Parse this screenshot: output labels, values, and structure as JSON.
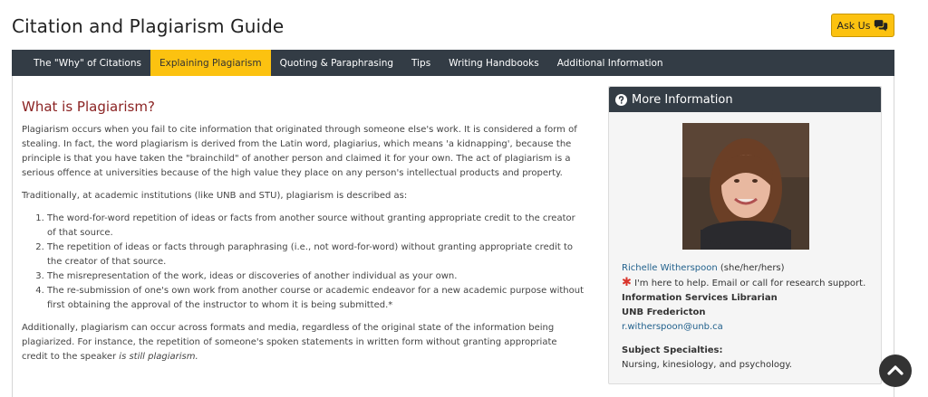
{
  "header": {
    "title": "Citation and Plagiarism Guide",
    "ask_us_label": "Ask Us"
  },
  "nav": {
    "tabs": [
      {
        "label": "The \"Why\" of Citations",
        "active": false
      },
      {
        "label": "Explaining Plagiarism",
        "active": true
      },
      {
        "label": "Quoting & Paraphrasing",
        "active": false
      },
      {
        "label": "Tips",
        "active": false
      },
      {
        "label": "Writing Handbooks",
        "active": false
      },
      {
        "label": "Additional Information",
        "active": false
      }
    ]
  },
  "main": {
    "heading": "What is Plagiarism?",
    "para1": "Plagiarism occurs when you fail to cite information that originated through someone else's work.  It is considered a form of stealing.  In fact, the word plagiarism is derived from the Latin word, plagiarius, which means 'a kidnapping', because the principle is that you have taken the \"brainchild\" of another person and claimed it for your own.  The act of plagiarism is a serious offence at universities because of the high value they place on any person's intellectual products and property.",
    "para2": "Traditionally, at academic institutions (like UNB and STU), plagiarism is described as:",
    "list": [
      "The word-for-word repetition of ideas or facts from another source without granting appropriate credit to the creator of that source.",
      "The repetition of ideas or facts through paraphrasing (i.e., not word-for-word) without granting appropriate credit to the creator of that source.",
      "The misrepresentation of the work, ideas or discoveries of another individual as your own.",
      "The re-submission of one's own work from another course or academic endeavor for a new academic purpose without first obtaining the approval of the instructor to whom it is being submitted.*"
    ],
    "para3_start": "Additionally, plagiarism can occur across formats and media, regardless of the original state of the information being plagiarized.  For instance, the repetition of someone's spoken statements in written form without granting appropriate credit to the speaker ",
    "para3_em": "is still plagiarism."
  },
  "sidebar": {
    "title": "More Information",
    "name": "Richelle Witherspoon",
    "pronouns": " (she/her/hers)",
    "help_text": "I'm here to help. Email or call for research support.",
    "job_title": "Information Services Librarian",
    "campus": "UNB Fredericton",
    "email": "r.witherspoon@unb.ca",
    "specialties_label": "Subject Specialties:",
    "specialties": "Nursing, kinesiology, and psychology."
  },
  "colors": {
    "accent": "#fcc210",
    "nav_bg": "#333c45",
    "heading": "#8b2323",
    "link": "#1f5f8b"
  }
}
